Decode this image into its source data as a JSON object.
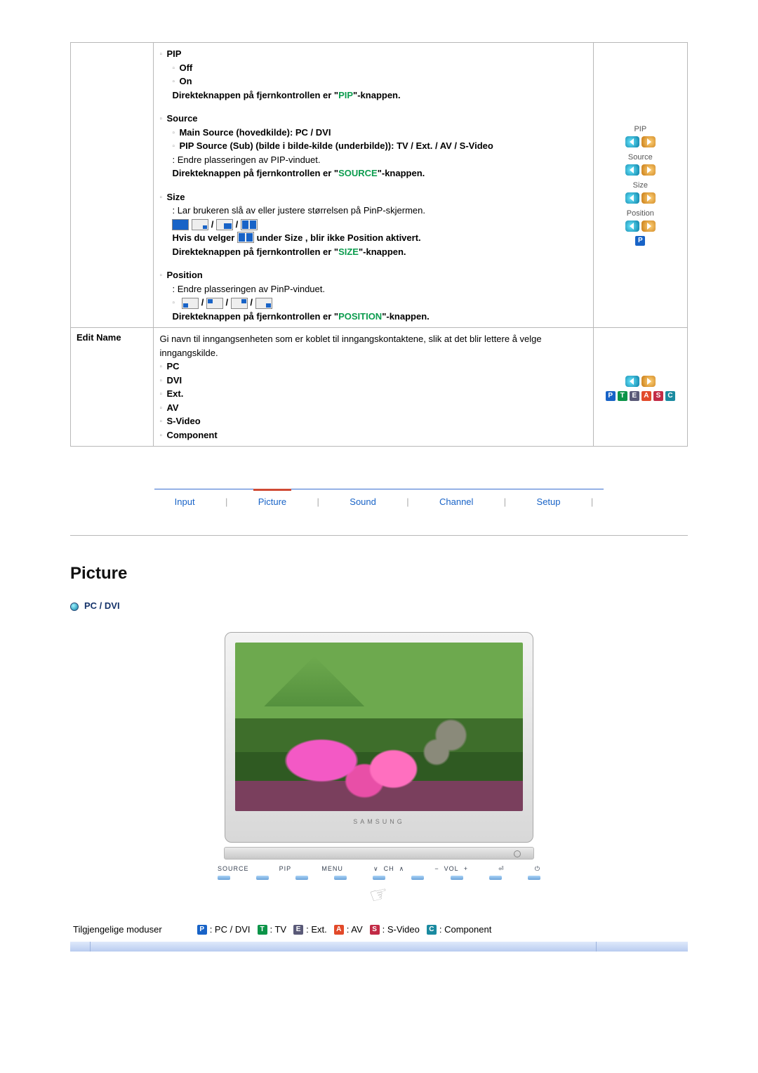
{
  "row1": {
    "pip": {
      "title": "PIP",
      "off": "Off",
      "on": "On",
      "direct_pre": "Direkteknappen på fjernkontrollen er \"",
      "direct_key": "PIP",
      "direct_post": "\"-knappen."
    },
    "source": {
      "title": "Source",
      "main": "Main Source (hovedkilde): PC / DVI",
      "pip": "PIP Source (Sub) (bilde i bilde-kilde (underbilde)): TV / Ext. / AV / S-Video",
      "desc": ": Endre plasseringen av PIP-vinduet.",
      "direct_pre": "Direkteknappen på fjernkontrollen er \"",
      "direct_key": "SOURCE",
      "direct_post": "\"-knappen."
    },
    "size": {
      "title": "Size",
      "desc": ": Lar brukeren slå av eller justere størrelsen på PinP-skjermen.",
      "warn_pre": "Hvis du velger ",
      "warn_post": " under Size , blir ikke Position aktivert.",
      "direct_pre": "Direkteknappen på fjernkontrollen er \"",
      "direct_key": "SIZE",
      "direct_post": "\"-knappen."
    },
    "position": {
      "title": "Position",
      "desc": ": Endre plasseringen av PinP-vinduet.",
      "direct_pre": "Direkteknappen på fjernkontrollen er \"",
      "direct_key": "POSITION",
      "direct_post": "\"-knappen."
    },
    "side": {
      "pip": "PIP",
      "source": "Source",
      "size": "Size",
      "position": "Position"
    }
  },
  "row2": {
    "name": "Edit Name",
    "desc": "Gi navn til inngangsenheten som er koblet til inngangskontaktene, slik at det blir lettere å velge inngangskilde.",
    "items": {
      "pc": "PC",
      "dvi": "DVI",
      "ext": "Ext.",
      "av": "AV",
      "sv": "S-Video",
      "comp": "Component"
    }
  },
  "tabs": {
    "input": "Input",
    "picture": "Picture",
    "sound": "Sound",
    "channel": "Channel",
    "setup": "Setup"
  },
  "section": {
    "title": "Picture",
    "sub": "PC / DVI"
  },
  "monitor": {
    "brand": "SAMSUNG",
    "controls": {
      "source": "SOURCE",
      "pip": "PIP",
      "menu": "MENU",
      "chdn": "∨",
      "ch": "CH",
      "chup": "∧",
      "minus": "−",
      "vol": "VOL",
      "plus": "+",
      "enter": "⏎",
      "power": "⏻"
    }
  },
  "modes": {
    "label": "Tilgjengelige moduser",
    "p": ": PC / DVI",
    "t": ": TV",
    "e": ": Ext.",
    "a": ": AV",
    "s": ": S-Video",
    "c": ": Component"
  },
  "badges": {
    "P": "P",
    "T": "T",
    "E": "E",
    "A": "A",
    "S": "S",
    "C": "C"
  }
}
